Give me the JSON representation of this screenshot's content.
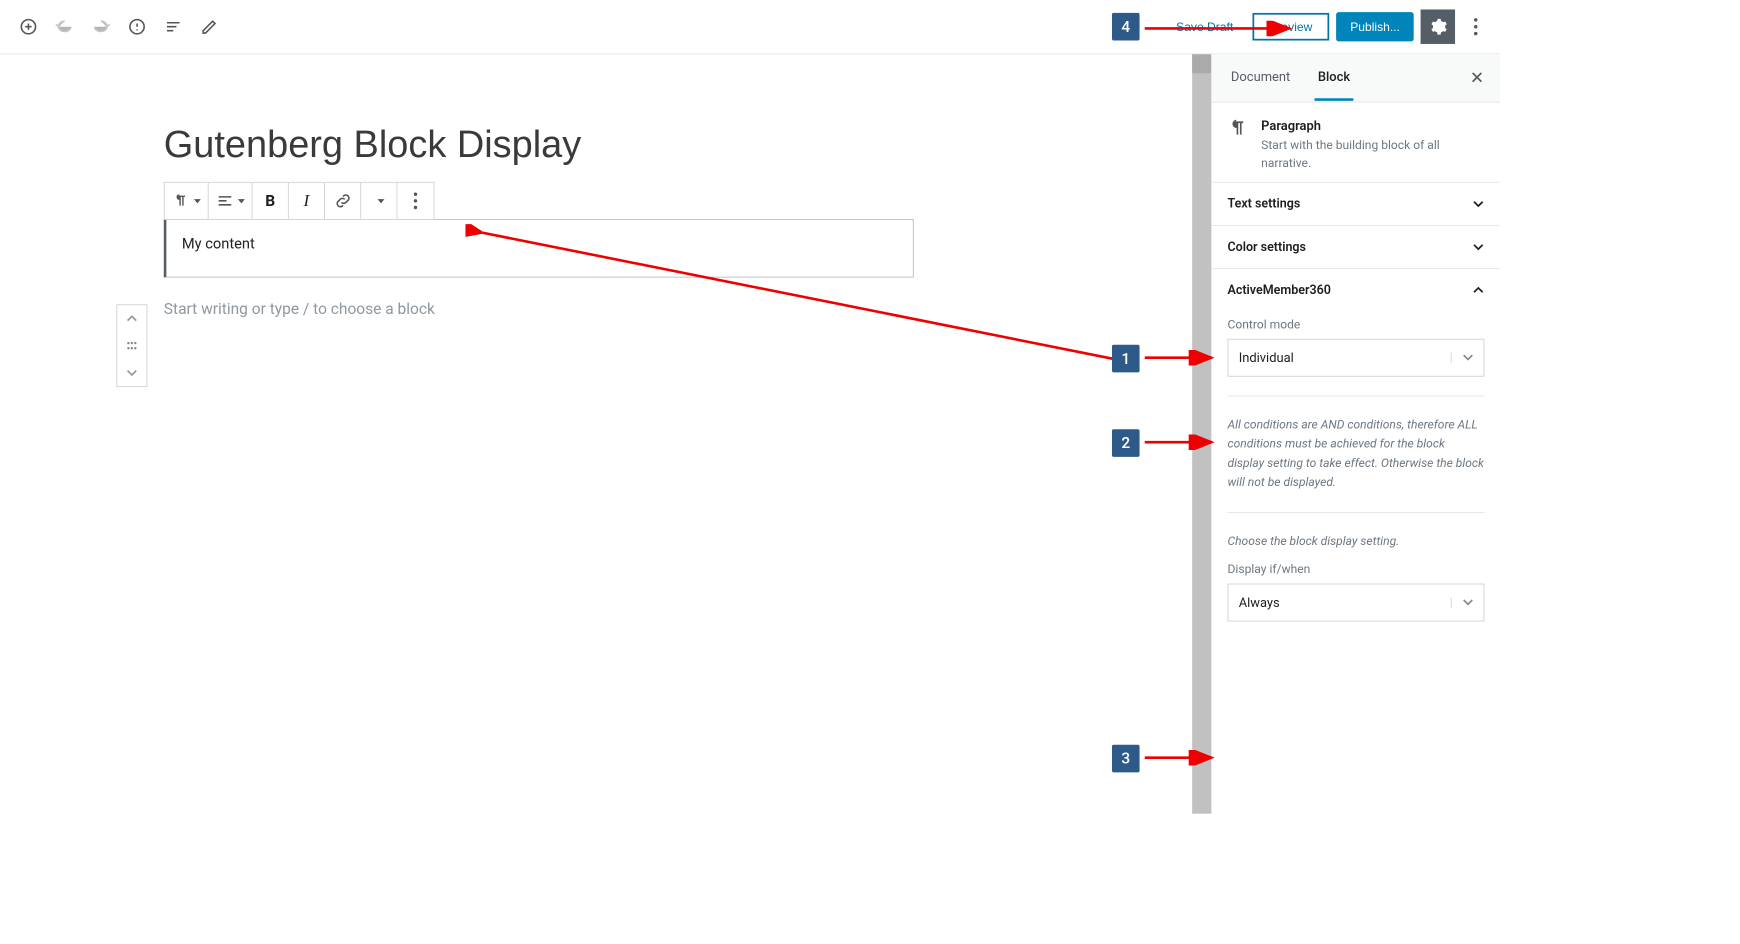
{
  "topbar": {
    "save_draft": "Save Draft",
    "preview": "Preview",
    "publish": "Publish..."
  },
  "canvas": {
    "title": "Gutenberg Block Display",
    "para_content": "My content",
    "placeholder": "Start writing or type / to choose a block"
  },
  "sidebar": {
    "tabs": {
      "document": "Document",
      "block": "Block"
    },
    "block_panel": {
      "name": "Paragraph",
      "desc": "Start with the building block of all narrative."
    },
    "panels": {
      "text": "Text settings",
      "color": "Color settings",
      "am360": "ActiveMember360"
    },
    "am360": {
      "control_mode_label": "Control mode",
      "control_mode_value": "Individual",
      "note": "All conditions are AND conditions, therefore ALL conditions must be achieved for the block display setting to take effect. Otherwise the block will not be displayed.",
      "choose_note": "Choose the block display setting.",
      "display_label": "Display if/when",
      "display_value": "Always"
    }
  },
  "annotations": {
    "b1": "1",
    "b2": "2",
    "b3": "3",
    "b4": "4"
  }
}
